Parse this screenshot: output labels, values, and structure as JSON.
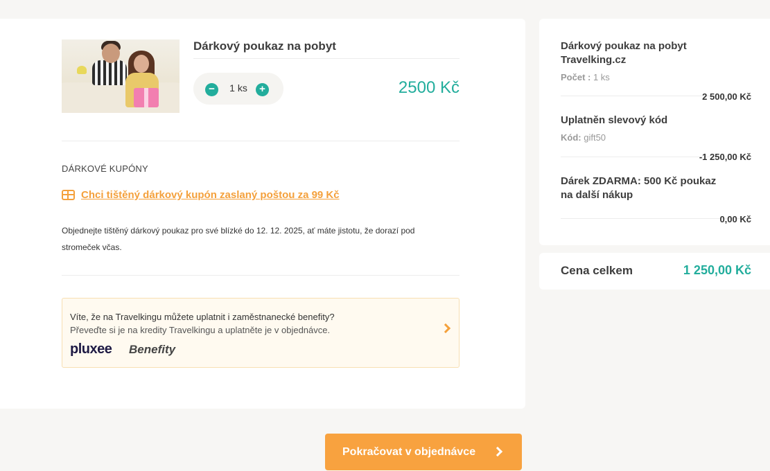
{
  "product": {
    "title": "Dárkový poukaz na pobyt",
    "quantity": "1 ks",
    "minus_symbol": "−",
    "plus_symbol": "+",
    "price": "2500 Kč"
  },
  "coupons": {
    "heading": "DÁRKOVÉ KUPÓNY",
    "link_text": "Chci tištěný dárkový kupón zaslaný poštou za 99 Kč",
    "note": "Objednejte tištěný dárkový poukaz pro své blízké do 12. 12. 2025, ať máte jistotu, že dorazí pod stromeček včas."
  },
  "benefits": {
    "line1": "Víte, že na Travelkingu můžete uplatnit i zaměstnanecké benefity?",
    "line2": "Převeďte si je na kredity Travelkingu a uplatněte je v objednávce.",
    "logo1": "pluxee",
    "logo2": "Benefity"
  },
  "summary": {
    "items": [
      {
        "title": "Dárkový poukaz na pobyt Travelking.cz",
        "meta_label": "Počet :",
        "meta_value": "1 ks",
        "amount": "2 500,00 Kč"
      },
      {
        "title": "Uplatněn slevový kód",
        "meta_label": "Kód:",
        "meta_value": "gift50",
        "amount": "-1 250,00 Kč"
      },
      {
        "title": "Dárek ZDARMA: 500 Kč poukaz na další nákup",
        "meta_label": "",
        "meta_value": "",
        "amount": "0,00 Kč"
      }
    ],
    "total_label": "Cena celkem",
    "total_value": "1 250,00 Kč"
  },
  "continue_button": {
    "label": "Pokračovat v objednávce"
  },
  "colors": {
    "accent": "#22ad9c",
    "orange": "#f8a23f"
  },
  "icons": {
    "coupon": "gift-voucher-icon",
    "chevron": "chevron-right-icon"
  }
}
